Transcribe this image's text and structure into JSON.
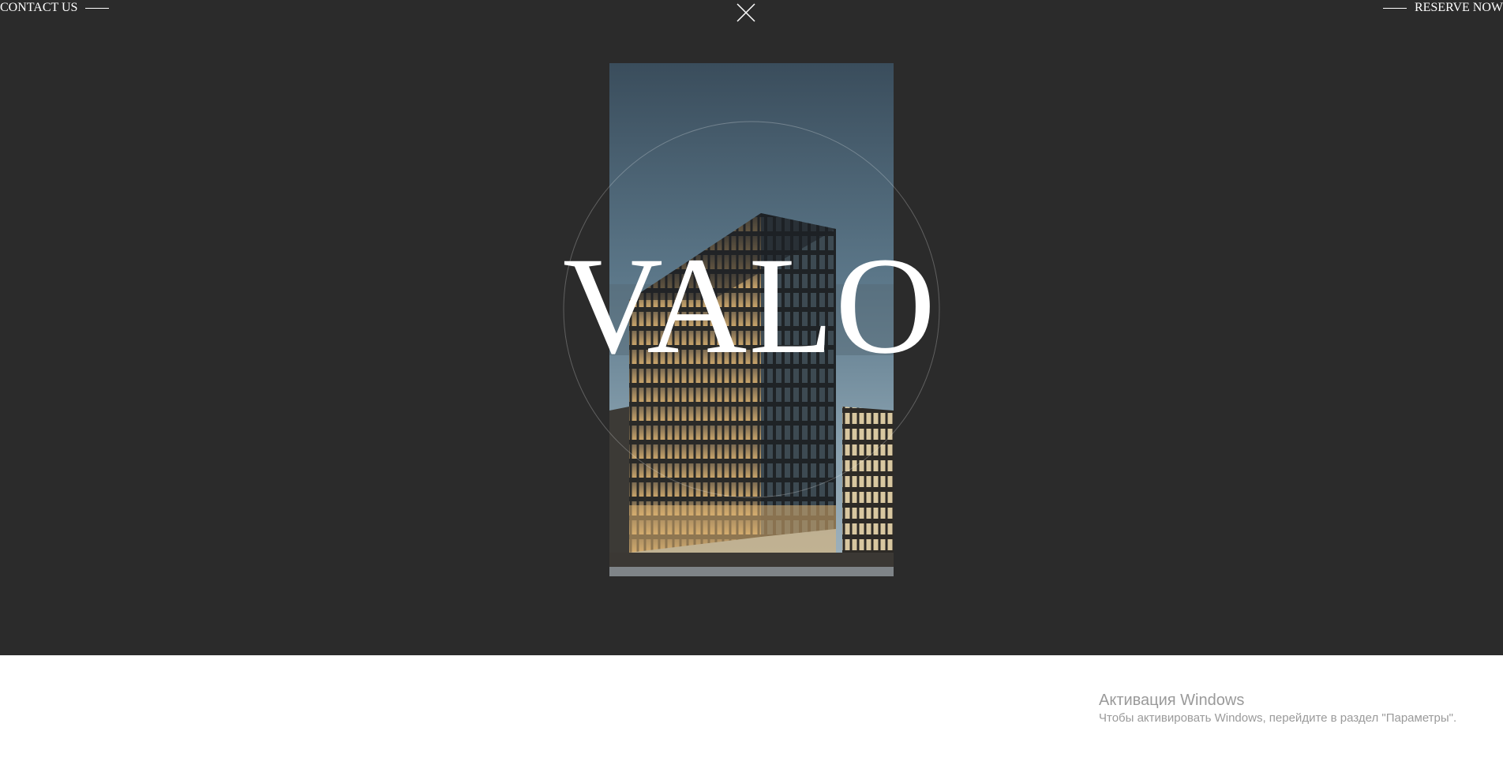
{
  "nav": {
    "contact_label": "CONTACT US",
    "reserve_label": "RESERVE NOW"
  },
  "hero": {
    "brand_title": "VALO",
    "background_color": "#2b2b2b"
  },
  "icons": {
    "close": "close-icon"
  },
  "system_watermark": {
    "title": "Активация Windows",
    "text": "Чтобы активировать Windows, перейдите в раздел \"Параметры\"."
  }
}
